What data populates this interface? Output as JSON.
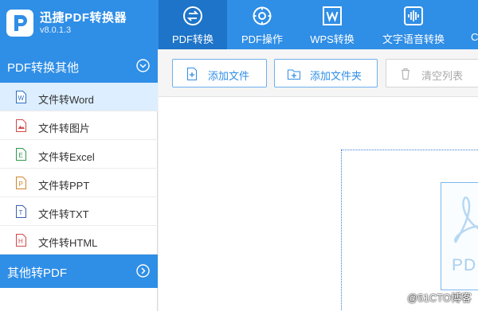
{
  "app": {
    "title": "迅捷PDF转换器",
    "version": "v8.0.1.3",
    "logo_letter": "P"
  },
  "nav": [
    {
      "label": "PDF转换",
      "icon": "swap-arrows-icon",
      "active": true
    },
    {
      "label": "PDF操作",
      "icon": "gear-icon",
      "active": false
    },
    {
      "label": "WPS转换",
      "icon": "wps-w-icon",
      "active": false
    },
    {
      "label": "文字语音转换",
      "icon": "sound-wave-icon",
      "active": false
    },
    {
      "label": "C",
      "icon": "partial-icon",
      "active": false
    }
  ],
  "sidebar": {
    "group1": {
      "label": "PDF转换其他",
      "icon": "chevron-up-icon"
    },
    "items": [
      {
        "label": "文件转Word",
        "icon": "word-file-icon",
        "color": "#2b6cc4",
        "active": true
      },
      {
        "label": "文件转图片",
        "icon": "image-file-icon",
        "color": "#d04a4a",
        "active": false
      },
      {
        "label": "文件转Excel",
        "icon": "excel-file-icon",
        "color": "#2e9a4a",
        "active": false
      },
      {
        "label": "文件转PPT",
        "icon": "ppt-file-icon",
        "color": "#d0862e",
        "active": false
      },
      {
        "label": "文件转TXT",
        "icon": "txt-file-icon",
        "color": "#3a5fb0",
        "active": false
      },
      {
        "label": "文件转HTML",
        "icon": "html-file-icon",
        "color": "#d04a4a",
        "active": false
      }
    ],
    "group2": {
      "label": "其他转PDF",
      "icon": "chevron-right-icon"
    }
  },
  "toolbar": {
    "add_file": "添加文件",
    "add_folder": "添加文件夹",
    "clear_list": "清空列表"
  },
  "dropzone": {
    "pdf_text": "PD"
  },
  "watermark": "@51CTO博客",
  "colors": {
    "brand": "#2f8ee6",
    "active_tab": "#1d74c8",
    "sidebar_active": "#dceeff"
  }
}
